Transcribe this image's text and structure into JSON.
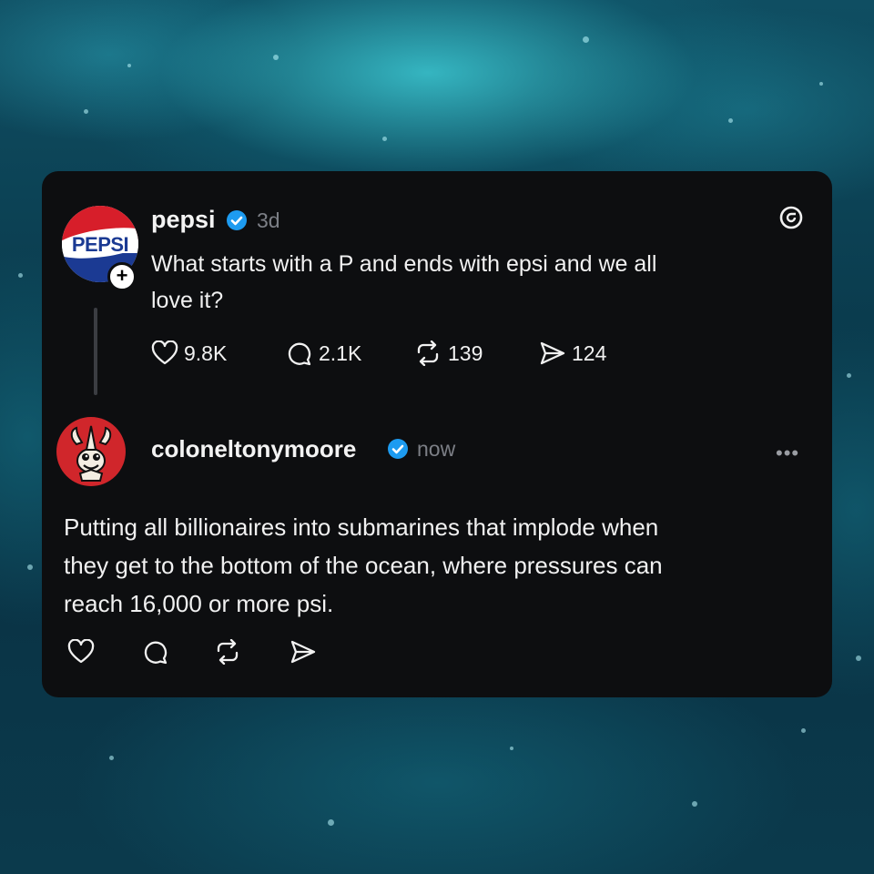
{
  "post": {
    "author": "pepsi",
    "time": "3d",
    "text_line1": "What starts with a P and ends with epsi and we all",
    "text_line2": "love it?",
    "avatar_text": "PEPSI",
    "follow_badge": "+",
    "stats": {
      "likes": "9.8K",
      "replies": "2.1K",
      "reposts": "139",
      "shares": "124"
    }
  },
  "reply": {
    "author": "coloneltonymoore",
    "time": "now",
    "more": "•••",
    "text_line1": "Putting all billionaires into submarines that implode when",
    "text_line2": "they get to the bottom of the ocean, where pressures can",
    "text_line3": "reach 16,000 or more psi."
  },
  "colors": {
    "card_bg": "#0d0e10",
    "verified": "#1d9bf0",
    "pepsi_red": "#d71e2a",
    "pepsi_blue": "#1b3a93",
    "muted_text": "#7c7f86"
  },
  "icons": {
    "app": "threads-icon",
    "like": "heart-icon",
    "reply": "comment-icon",
    "repost": "repost-icon",
    "share": "send-icon",
    "verified": "verified-badge-icon"
  }
}
